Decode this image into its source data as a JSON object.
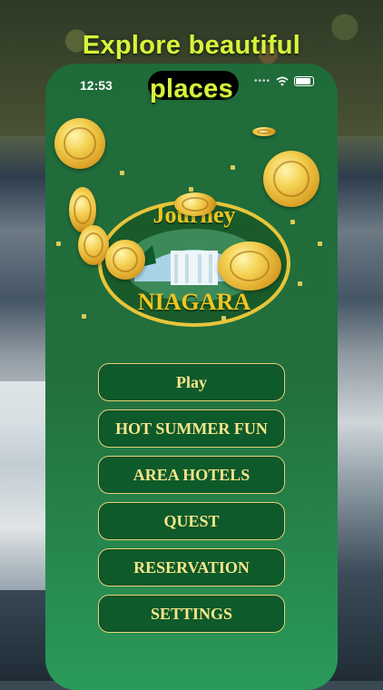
{
  "headline": {
    "line1": "Explore beautiful",
    "line2": "places"
  },
  "status_bar": {
    "time": "12:53"
  },
  "logo": {
    "title_top": "Journey",
    "title_bottom": "NIAGARA"
  },
  "menu": {
    "items": [
      {
        "label": "Play"
      },
      {
        "label": "HOT SUMMER FUN"
      },
      {
        "label": "AREA HOTELS"
      },
      {
        "label": "QUEST"
      },
      {
        "label": "RESERVATION"
      },
      {
        "label": "SETTINGS"
      }
    ]
  },
  "colors": {
    "headline": "#d8f33b",
    "phone_bg": "#226f3c",
    "button_bg": "#0e5a2a",
    "button_border": "#e9d47a",
    "button_text": "#f6e58a",
    "logo_text": "#f0c51f"
  },
  "icons": [
    "signal-icon",
    "wifi-icon",
    "battery-icon",
    "coin-icon"
  ]
}
